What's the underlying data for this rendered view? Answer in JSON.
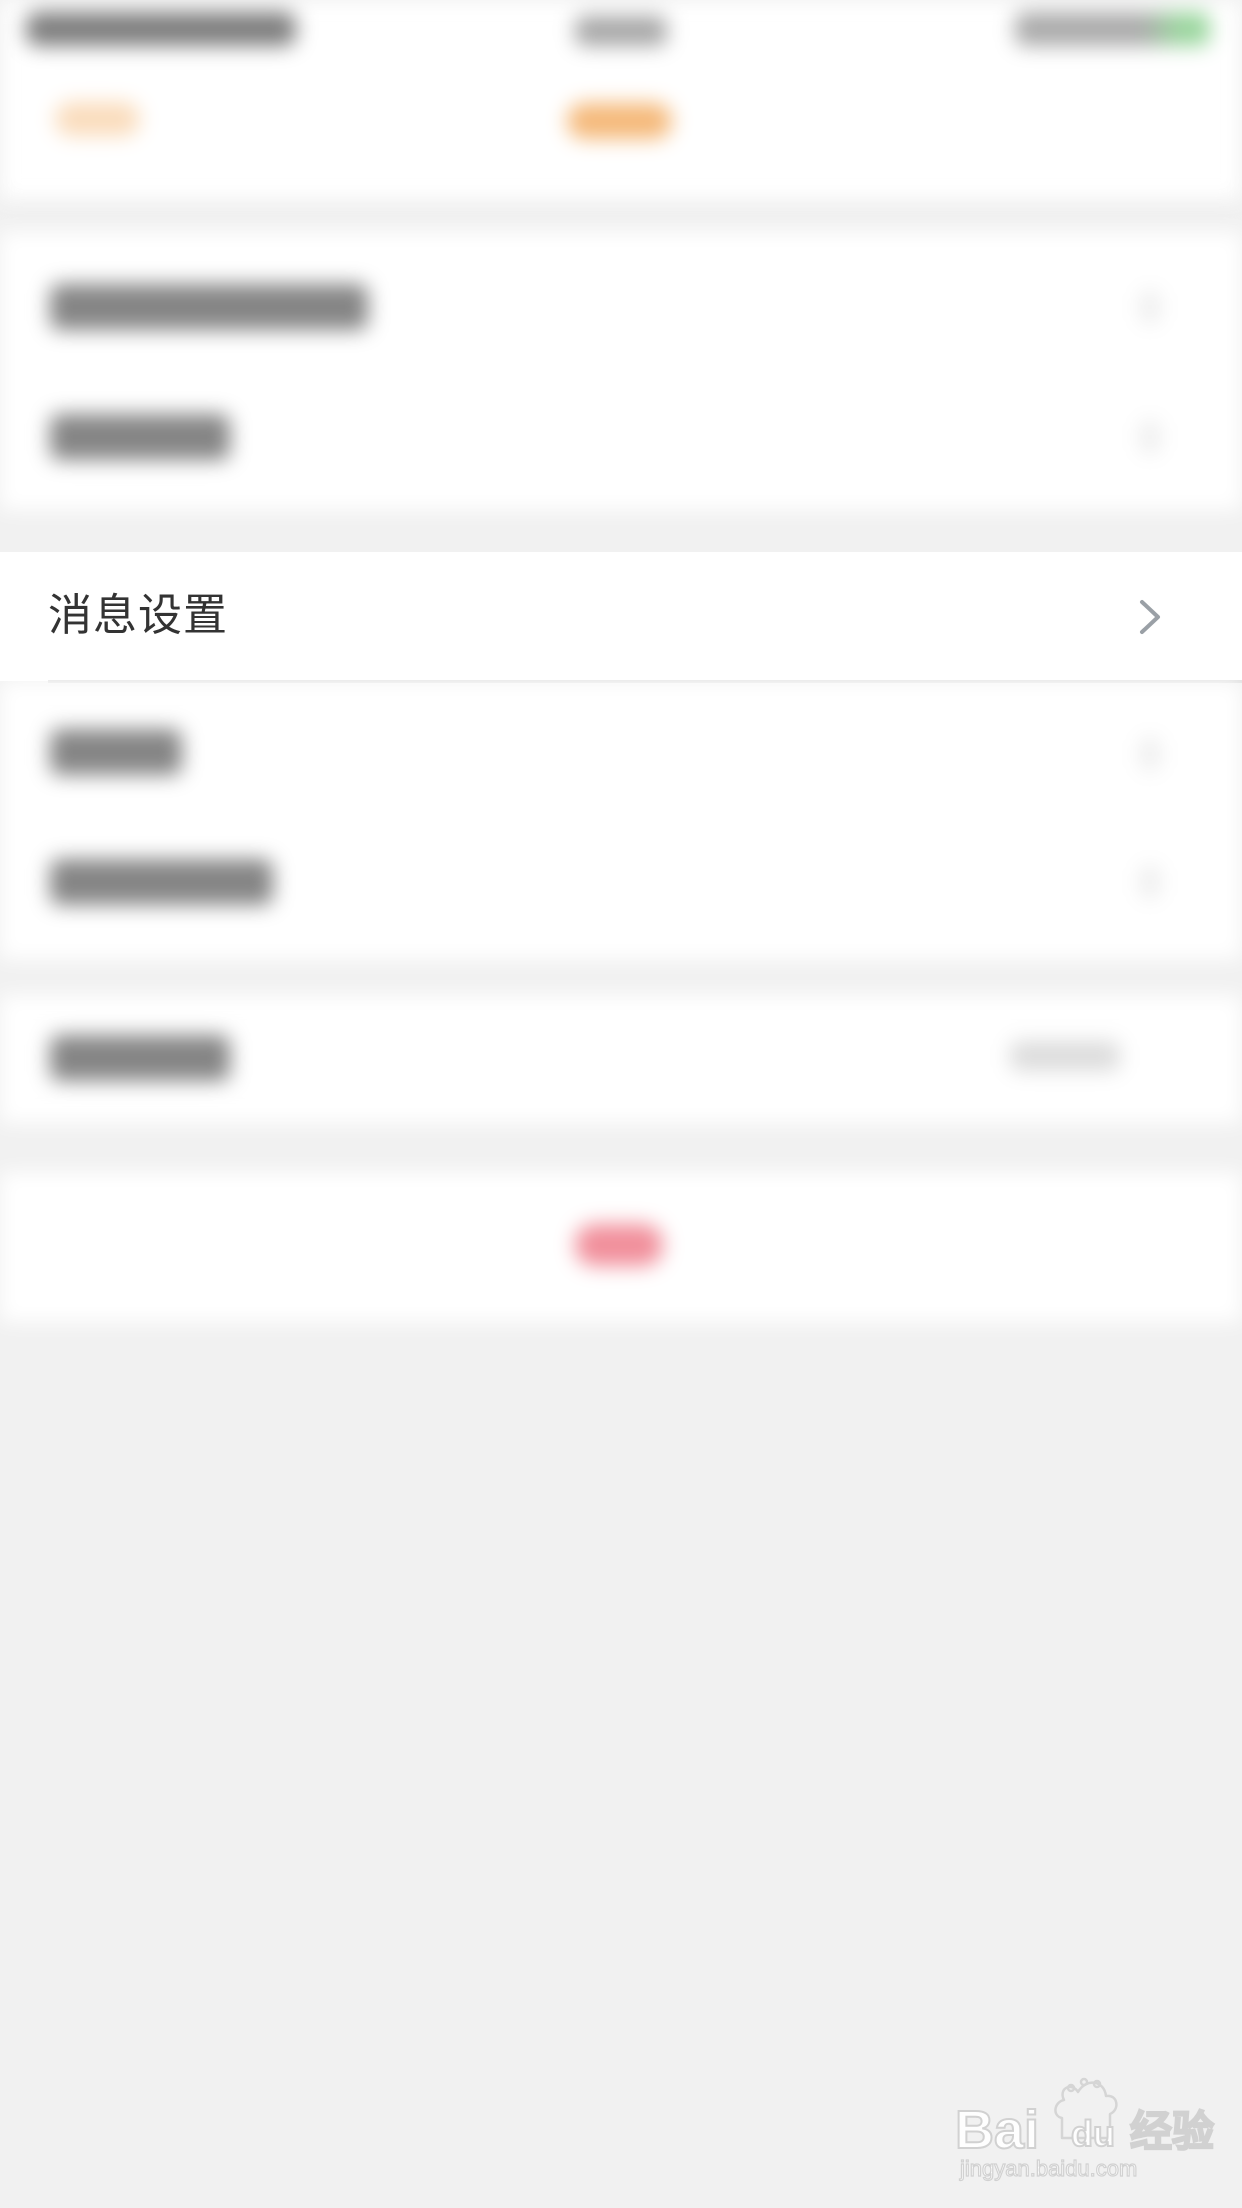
{
  "list": {
    "message_settings": {
      "label": "消息设置",
      "icon": "chevron-right-icon"
    }
  },
  "watermark": {
    "brand_line_1": "Bai",
    "brand_line_2": "du",
    "brand_line_3": "经验",
    "url": "jingyan.baidu.com"
  },
  "colors": {
    "page_background": "#f1f1f1",
    "row_background": "#ffffff",
    "label_text": "#333333",
    "chevron": "#9aa0a6",
    "divider": "#dcdcdc",
    "orange_accent": "#f2a24e",
    "red_accent": "#ee7b8a",
    "green_status": "#79c97e"
  }
}
